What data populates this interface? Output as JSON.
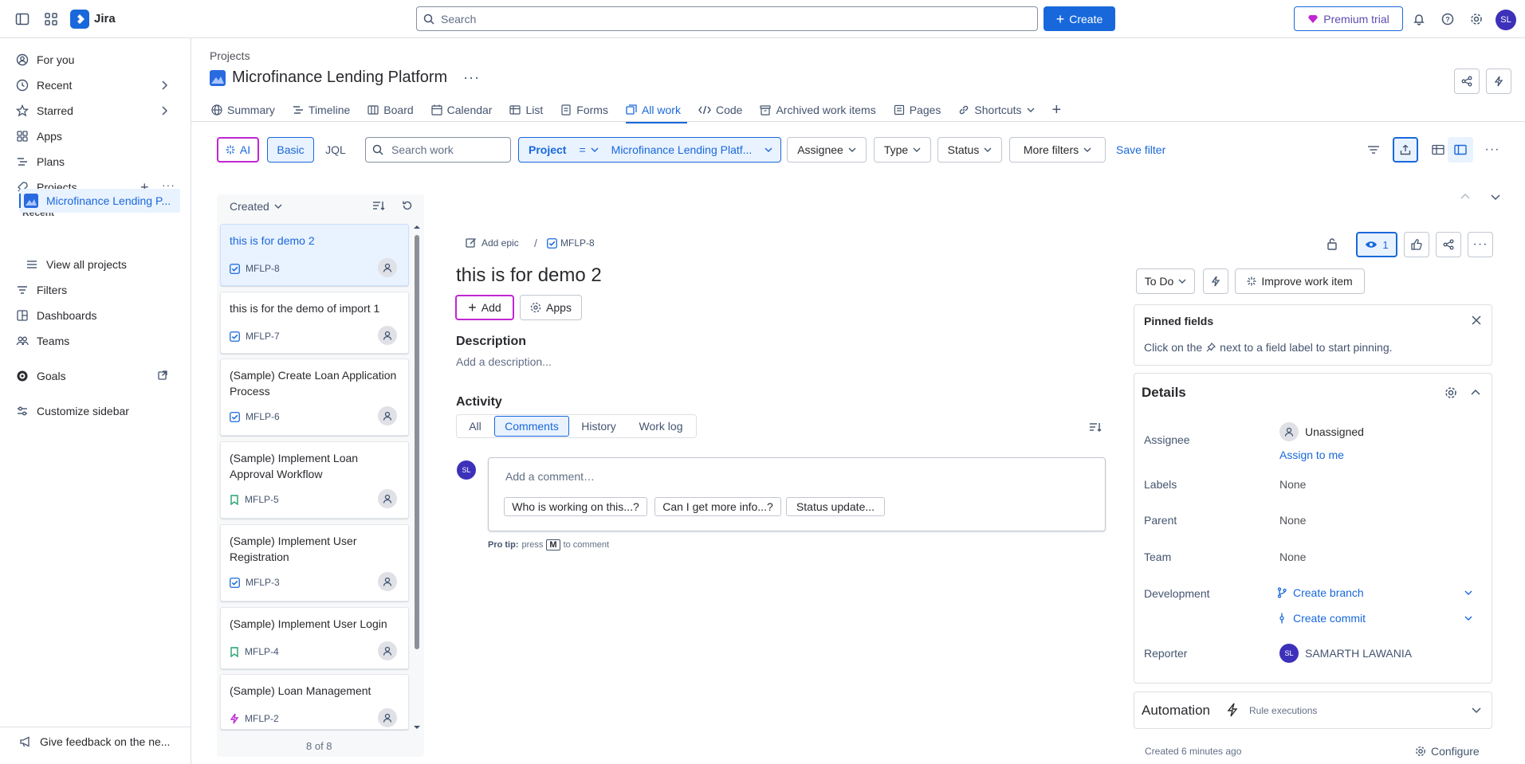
{
  "topbar": {
    "app_name": "Jira",
    "search_placeholder": "Search",
    "create_label": "Create",
    "premium_label": "Premium trial",
    "user_initials": "SL"
  },
  "sidebar": {
    "items": [
      {
        "label": "For you"
      },
      {
        "label": "Recent"
      },
      {
        "label": "Starred"
      },
      {
        "label": "Apps"
      },
      {
        "label": "Plans"
      },
      {
        "label": "Projects"
      },
      {
        "label": "Filters"
      },
      {
        "label": "Dashboards"
      },
      {
        "label": "Teams"
      },
      {
        "label": "Goals"
      },
      {
        "label": "Customize sidebar"
      }
    ],
    "recent_heading": "Recent",
    "recent_project": "Microfinance Lending P...",
    "view_all_projects": "View all projects",
    "feedback": "Give feedback on the ne..."
  },
  "header": {
    "breadcrumb": "Projects",
    "title": "Microfinance Lending Platform",
    "tabs": [
      "Summary",
      "Timeline",
      "Board",
      "Calendar",
      "List",
      "Forms",
      "All work",
      "Code",
      "Archived work items",
      "Pages",
      "Shortcuts"
    ],
    "active_tab": "All work"
  },
  "filters": {
    "ai_label": "AI",
    "basic_label": "Basic",
    "jql_label": "JQL",
    "search_placeholder": "Search work",
    "project_key": "Project",
    "project_op": "=",
    "project_value": "Microfinance Lending Platf...",
    "assignee": "Assignee",
    "type": "Type",
    "status": "Status",
    "more_filters": "More filters",
    "save_filter": "Save filter"
  },
  "list": {
    "sort_label": "Created",
    "count_label": "8 of 8",
    "items": [
      {
        "title": "this is for demo 2",
        "key": "MFLP-8",
        "type": "task"
      },
      {
        "title": "this is for the demo of import 1",
        "key": "MFLP-7",
        "type": "task"
      },
      {
        "title": "(Sample) Create Loan Application Process",
        "key": "MFLP-6",
        "type": "task"
      },
      {
        "title": "(Sample) Implement Loan Approval Workflow",
        "key": "MFLP-5",
        "type": "story"
      },
      {
        "title": "(Sample) Implement User Registration",
        "key": "MFLP-3",
        "type": "task"
      },
      {
        "title": "(Sample) Implement User Login",
        "key": "MFLP-4",
        "type": "story"
      },
      {
        "title": "(Sample) Loan Management",
        "key": "MFLP-2",
        "type": "epic"
      }
    ]
  },
  "detail": {
    "add_epic": "Add epic",
    "key": "MFLP-8",
    "title": "this is for demo 2",
    "add_label": "Add",
    "apps_label": "Apps",
    "description_heading": "Description",
    "description_placeholder": "Add a description...",
    "activity_heading": "Activity",
    "activity_tabs": [
      "All",
      "Comments",
      "History",
      "Work log"
    ],
    "active_activity_tab": "Comments",
    "commenter_initials": "SL",
    "comment_placeholder": "Add a comment…",
    "suggestions": [
      "Who is working on this...?",
      "Can I get more info...?",
      "Status update..."
    ],
    "pro_tip_prefix": "Pro tip:",
    "pro_tip_press": "press",
    "pro_tip_key": "M",
    "pro_tip_suffix": "to comment",
    "watch_count": "1"
  },
  "right_panel": {
    "status": "To Do",
    "improve_label": "Improve work item",
    "pinned_title": "Pinned fields",
    "pinned_hint_before": "Click on the",
    "pinned_hint_after": "next to a field label to start pinning.",
    "details_title": "Details",
    "fields": {
      "assignee_label": "Assignee",
      "assignee_value": "Unassigned",
      "assign_to_me": "Assign to me",
      "labels_label": "Labels",
      "labels_value": "None",
      "parent_label": "Parent",
      "parent_value": "None",
      "team_label": "Team",
      "team_value": "None",
      "development_label": "Development",
      "create_branch": "Create branch",
      "create_commit": "Create commit",
      "reporter_label": "Reporter",
      "reporter_initials": "SL",
      "reporter_name": "SAMARTH LAWANIA"
    },
    "automation_title": "Automation",
    "rule_executions": "Rule executions",
    "created_ago": "Created 6 minutes ago",
    "configure": "Configure"
  },
  "colors": {
    "brand": "#1868db",
    "ai_outline": "#c026d3",
    "avatar": "#3d31b9"
  }
}
